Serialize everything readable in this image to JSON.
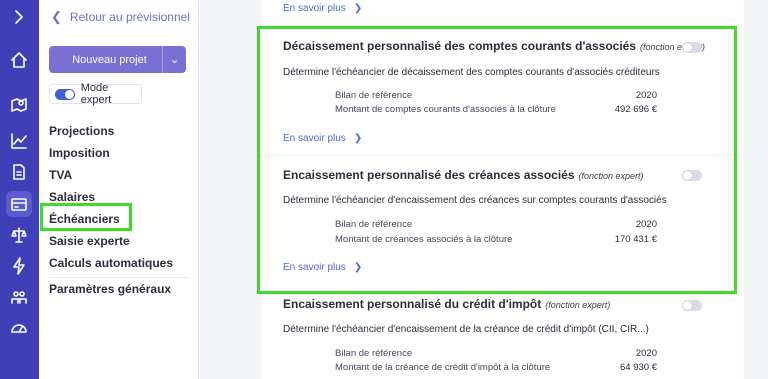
{
  "sidebar": {
    "back_label": "Retour au prévisionnel",
    "new_project_label": "Nouveau projet",
    "expert_mode_label": "Mode expert",
    "items": [
      {
        "label": "Projections"
      },
      {
        "label": "Imposition"
      },
      {
        "label": "TVA"
      },
      {
        "label": "Salaires"
      },
      {
        "label": "Échéanciers"
      },
      {
        "label": "Saisie experte"
      },
      {
        "label": "Calculs automatiques"
      }
    ],
    "settings_label": "Paramètres généraux"
  },
  "main": {
    "top_link": "En savoir plus",
    "sections": [
      {
        "title": "Décaissement personnalisé des comptes courants d'associés",
        "subtitle": "(fonction expert)",
        "description": "Détermine l'échéancier de décaissement des comptes courants d'associés créditeurs",
        "ref_label": "Bilan de référence",
        "ref_value": "2020",
        "amount_label": "Montant de comptes courants d'associés à la clôture",
        "amount_value": "492 696 €",
        "link": "En savoir plus"
      },
      {
        "title": "Encaissement personnalisé des créances associés",
        "subtitle": "(fonction expert)",
        "description": "Détermine l'échéancier d'encaissement des créances sur comptes courants d'associés",
        "ref_label": "Bilan de référence",
        "ref_value": "2020",
        "amount_label": "Montant de créances associés à la clôture",
        "amount_value": "170 431 €",
        "link": "En savoir plus"
      },
      {
        "title": "Encaissement personnalisé du crédit d'impôt",
        "subtitle": "(fonction expert)",
        "description": "Détermine l'échéancier d'encaissement de la créance de crédit d'impôt (CII, CIR...)",
        "ref_label": "Bilan de référence",
        "ref_value": "2020",
        "amount_label": "Montant de la créance de crédit d'impôt à la clôture",
        "amount_value": "64 930 €"
      }
    ]
  },
  "colors": {
    "rail": "#3f3fb8",
    "accent": "#7a6fd2",
    "link": "#4f6ad6",
    "highlight": "#3ddc28"
  },
  "icons": [
    "chevron-right-icon",
    "home-icon",
    "map-pin-icon",
    "chart-line-icon",
    "document-icon",
    "wallet-icon",
    "scale-icon",
    "bolt-icon",
    "group-icon",
    "gauge-icon"
  ]
}
